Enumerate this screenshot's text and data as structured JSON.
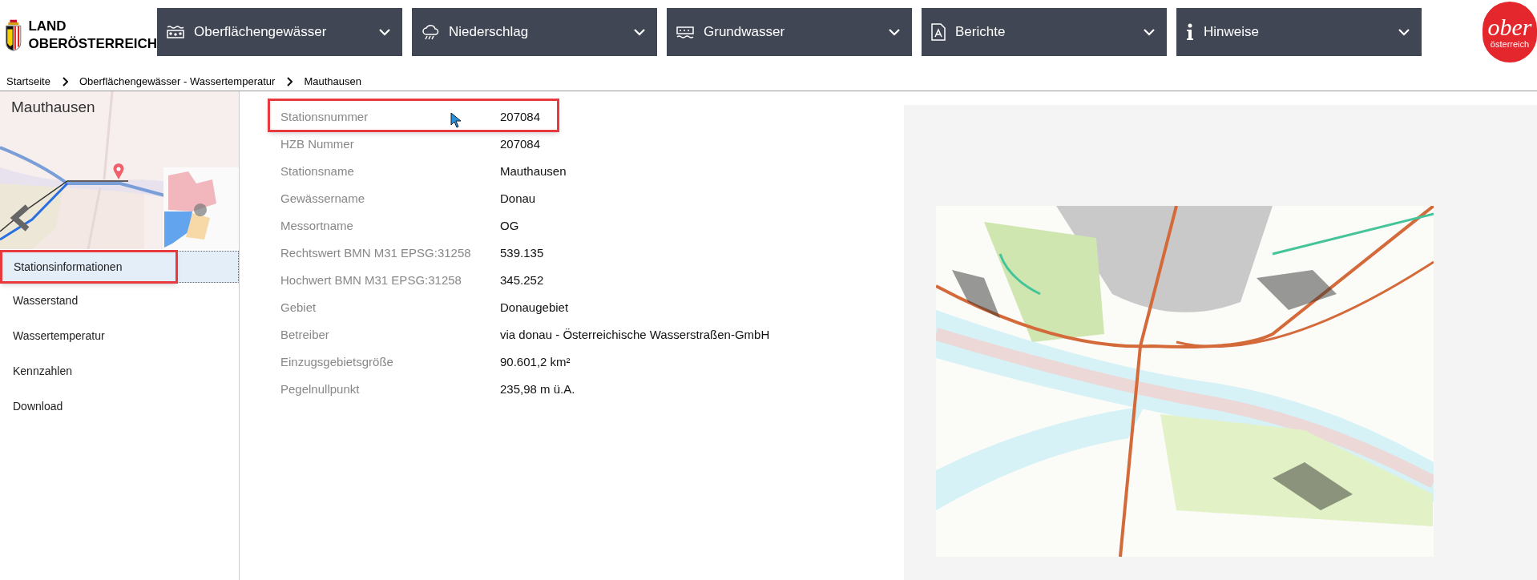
{
  "header": {
    "logo_lines": [
      "LAND",
      "OBERÖSTERREICH"
    ],
    "nav": [
      {
        "label": "Oberflächengewässer",
        "kind": "waves"
      },
      {
        "label": "Niederschlag",
        "kind": "rain"
      },
      {
        "label": "Grundwasser",
        "kind": "ground"
      },
      {
        "label": "Berichte",
        "kind": "pdf"
      },
      {
        "label": "Hinweise",
        "kind": "info"
      }
    ],
    "brand_badge": {
      "word": "ober",
      "sub": "österreich"
    }
  },
  "breadcrumb": [
    "Startseite",
    "Oberflächengewässer - Wassertemperatur",
    "Mauthausen"
  ],
  "sidebar": {
    "title": "Mauthausen",
    "items": [
      {
        "label": "Stationsinformationen",
        "selected": true,
        "highlighted": true
      },
      {
        "label": "Wasserstand",
        "selected": false,
        "highlighted": false
      },
      {
        "label": "Wassertemperatur",
        "selected": false,
        "highlighted": false
      },
      {
        "label": "Kennzahlen",
        "selected": false,
        "highlighted": false
      },
      {
        "label": "Download",
        "selected": false,
        "highlighted": false
      }
    ]
  },
  "station_info": [
    {
      "label": "Stationsnummer",
      "value": "207084",
      "highlighted": true
    },
    {
      "label": "HZB Nummer",
      "value": "207084",
      "highlighted": false
    },
    {
      "label": "Stationsname",
      "value": "Mauthausen",
      "highlighted": false
    },
    {
      "label": "Gewässername",
      "value": "Donau",
      "highlighted": false
    },
    {
      "label": "Messortname",
      "value": "OG",
      "highlighted": false
    },
    {
      "label": "Rechtswert BMN M31 EPSG:31258",
      "value": "539.135",
      "highlighted": false
    },
    {
      "label": "Hochwert BMN M31 EPSG:31258",
      "value": "345.252",
      "highlighted": false
    },
    {
      "label": "Gebiet",
      "value": "Donaugebiet",
      "highlighted": false
    },
    {
      "label": "Betreiber",
      "value": "via donau - Österreichische Wasserstraßen-GmbH",
      "highlighted": false
    },
    {
      "label": "Einzugsgebietsgröße",
      "value": "90.601,2 km²",
      "highlighted": false
    },
    {
      "label": "Pegelnullpunkt",
      "value": "235,98 m ü.A.",
      "highlighted": false
    }
  ]
}
